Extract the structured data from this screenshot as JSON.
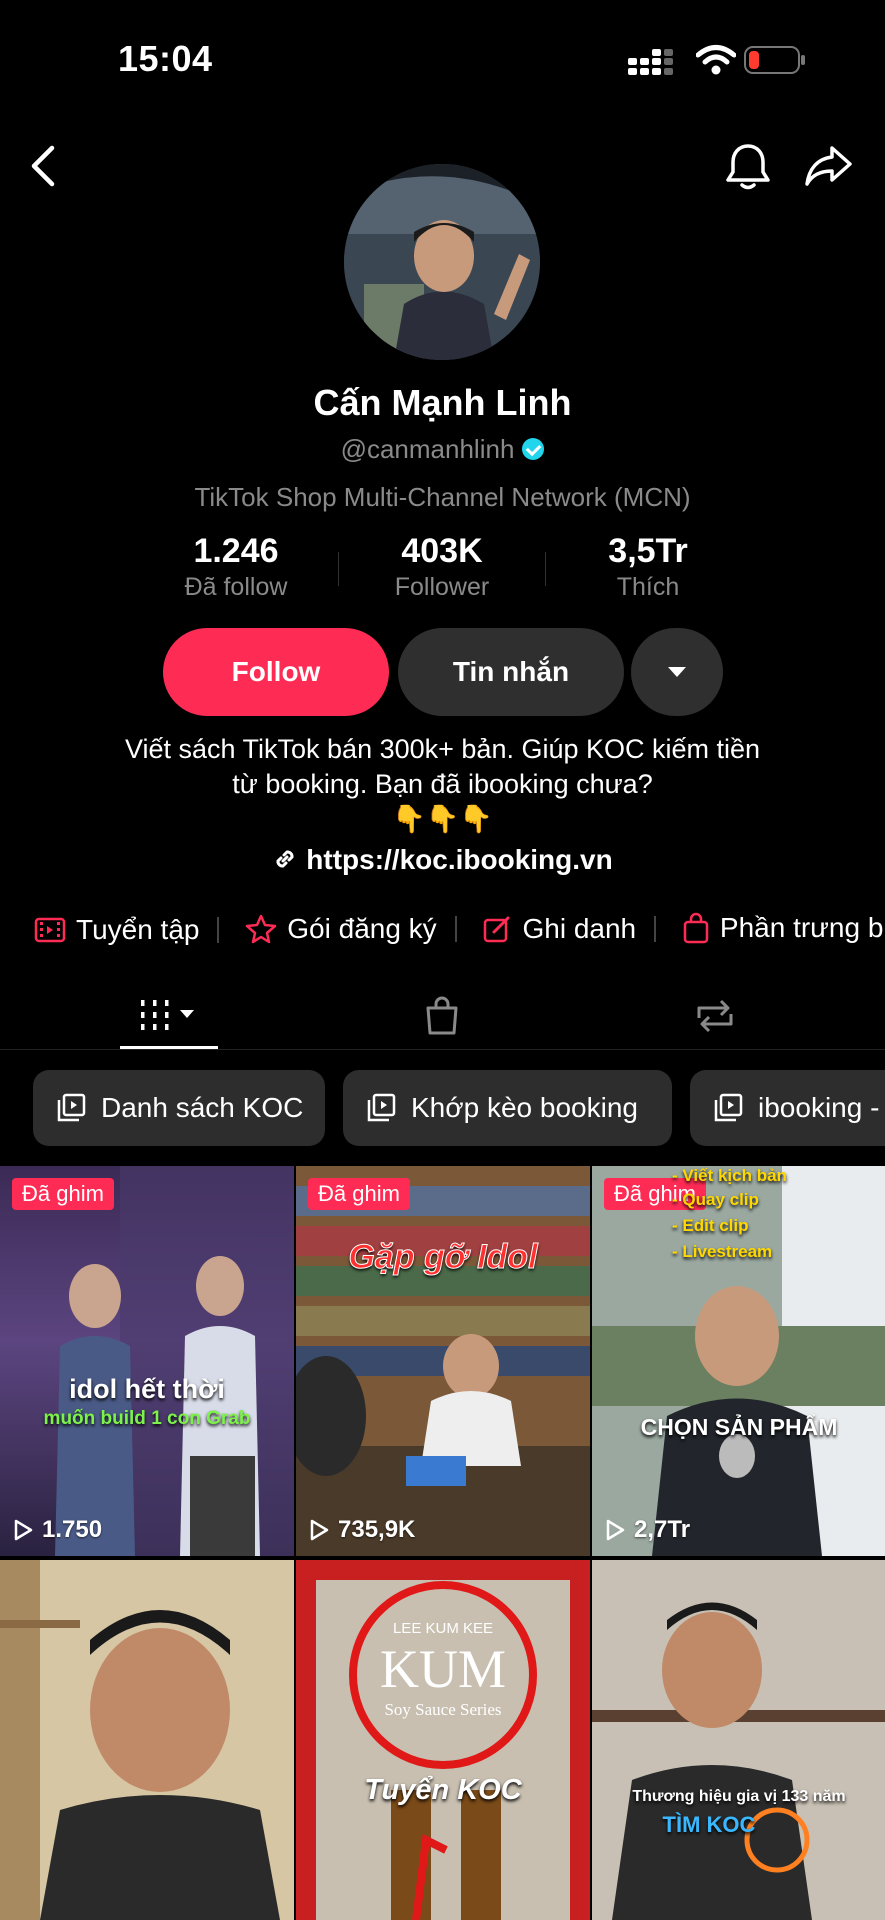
{
  "status": {
    "time": "15:04"
  },
  "profile": {
    "name": "Cấn Mạnh Linh",
    "handle": "@canmanhlinh",
    "category": "TikTok Shop Multi-Channel Network (MCN)",
    "stats": [
      {
        "value": "1.246",
        "label": "Đã follow"
      },
      {
        "value": "403K",
        "label": "Follower"
      },
      {
        "value": "3,5Tr",
        "label": "Thích"
      }
    ],
    "follow_label": "Follow",
    "message_label": "Tin nhắn",
    "bio_line1": "Viết sách TikTok bán 300k+ bản. Giúp KOC kiếm tiền",
    "bio_line2": "từ booking. Bạn đã ibooking chưa?",
    "bio_emoji": "👇👇👇",
    "link": "https://koc.ibooking.vn"
  },
  "chips": [
    {
      "label": "Tuyển tập",
      "icon": "film-icon"
    },
    {
      "label": "Gói đăng ký",
      "icon": "star-badge-icon"
    },
    {
      "label": "Ghi danh",
      "icon": "edit-icon"
    },
    {
      "label": "Phần trưng b",
      "icon": "shopping-bag-icon"
    }
  ],
  "tabs": [
    {
      "name": "videos",
      "icon": "grid-icon",
      "active": true
    },
    {
      "name": "shop",
      "icon": "bag-icon"
    },
    {
      "name": "reposts",
      "icon": "repost-icon"
    }
  ],
  "playlists": [
    {
      "label": "Danh sách KOC"
    },
    {
      "label": "Khớp kèo booking"
    },
    {
      "label": "ibooking -"
    }
  ],
  "videos": [
    {
      "pinned_label": "Đã ghim",
      "views": "1.750",
      "caption1": "idol hết thời",
      "caption2": "muốn build 1 con Grab"
    },
    {
      "pinned_label": "Đã ghim",
      "views": "735,9K",
      "caption1": "Gặp gỡ Idol"
    },
    {
      "pinned_label": "Đã ghim",
      "views": "2,7Tr",
      "caption1": "- Viết kịch bản",
      "caption2": "- Quay clip",
      "caption3": "- Edit clip",
      "caption4": "- Livestream",
      "caption5": "CHỌN SẢN PHẨM"
    },
    {
      "views": ""
    },
    {
      "caption1": "LEE KUM KEE",
      "caption2": "KUM",
      "caption3": "Soy Sauce Series",
      "caption4": "Tuyển KOC"
    },
    {
      "caption1": "Thương hiệu gia vị 133 năm",
      "caption2": "TÌM KOC"
    }
  ],
  "colors": {
    "accent": "#fe2c55",
    "verify": "#20d5ec",
    "background": "#000000",
    "button_dark": "#2f2f2f"
  }
}
